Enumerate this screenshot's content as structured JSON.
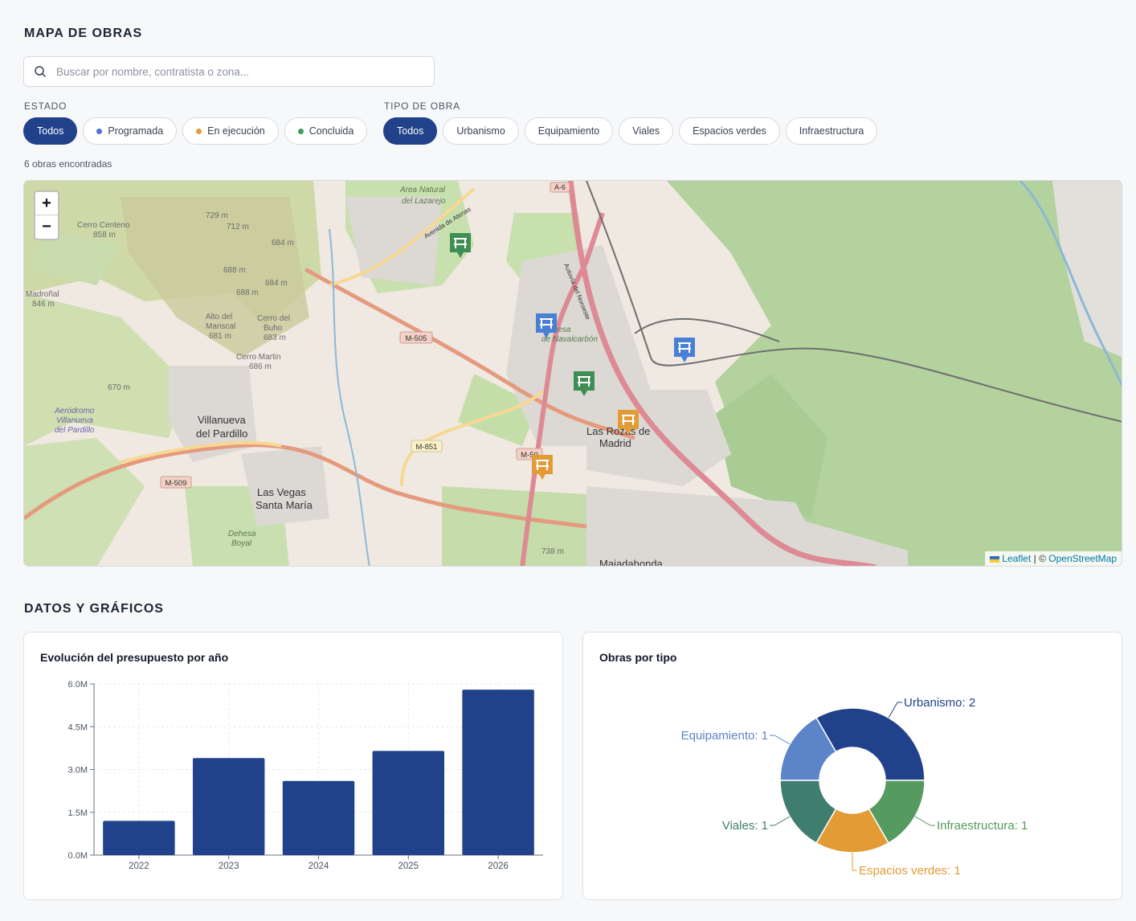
{
  "page": {
    "map_title": "MAPA DE OBRAS",
    "data_title": "DATOS Y GRÁFICOS"
  },
  "search": {
    "placeholder": "Buscar por nombre, contratista o zona...",
    "value": ""
  },
  "filters": {
    "estado_label": "ESTADO",
    "estado_options": [
      {
        "label": "Todos",
        "active": true,
        "dot": null
      },
      {
        "label": "Programada",
        "active": false,
        "dot": "#4a74d4"
      },
      {
        "label": "En ejecución",
        "active": false,
        "dot": "#e39b36"
      },
      {
        "label": "Concluida",
        "active": false,
        "dot": "#3f9a5e"
      }
    ],
    "tipo_label": "TIPO DE OBRA",
    "tipo_options": [
      {
        "label": "Todos",
        "active": true
      },
      {
        "label": "Urbanismo",
        "active": false
      },
      {
        "label": "Equipamiento",
        "active": false
      },
      {
        "label": "Viales",
        "active": false
      },
      {
        "label": "Espacios verdes",
        "active": false
      },
      {
        "label": "Infraestructura",
        "active": false
      }
    ]
  },
  "results": {
    "count_text": "6 obras encontradas"
  },
  "map": {
    "zoom_in": "+",
    "zoom_out": "−",
    "attribution": {
      "leaflet": "Leaflet",
      "separator": " | © ",
      "osm": "OpenStreetMap"
    },
    "labels": [
      "Area Natural",
      "del Lazarejo",
      "A-6",
      "729 m",
      "712 m",
      "684 m",
      "Cerro Centeno",
      "858 m",
      "688 m",
      "684 m",
      "688 m",
      "Madroñal",
      "846 m",
      "Alto del",
      "Mariscal",
      "681 m",
      "Cerro del",
      "Buho",
      "683 m",
      "Cerro Martin",
      "686 m",
      "670 m",
      "Aeródromo",
      "Villanueva",
      "del Pardillo",
      "Villanueva",
      "del Pardillo",
      "M-505",
      "M-851",
      "M-509",
      "M-50",
      "Las Vegas",
      "Santa María",
      "Las Rozas de",
      "Madrid",
      "Dehesa",
      "de Navalcarbón",
      "Dehesa",
      "Boyal",
      "738 m",
      "Majadahonda",
      "Autovía del Noroeste",
      "Avenida de Atenas"
    ],
    "markers": [
      {
        "status": "Concluida",
        "color": "#3f8e54"
      },
      {
        "status": "Programada",
        "color": "#4a7fd6"
      },
      {
        "status": "Programada",
        "color": "#4a7fd6"
      },
      {
        "status": "Concluida",
        "color": "#3f8e54"
      },
      {
        "status": "En ejecución",
        "color": "#e39b36"
      },
      {
        "status": "En ejecución",
        "color": "#e39b36"
      }
    ]
  },
  "charts": {
    "budget_title": "Evolución del presupuesto por año",
    "types_title": "Obras por tipo"
  },
  "chart_data": [
    {
      "type": "bar",
      "title": "Evolución del presupuesto por año",
      "categories": [
        "2022",
        "2023",
        "2024",
        "2025",
        "2026"
      ],
      "values": [
        1200000,
        3400000,
        2600000,
        3650000,
        5800000
      ],
      "yticks": [
        "0.0M",
        "1.5M",
        "3.0M",
        "4.5M",
        "6.0M"
      ],
      "ylim": [
        0,
        6000000
      ],
      "grid": true,
      "color": "#21428a"
    },
    {
      "type": "pie",
      "title": "Obras por tipo",
      "labels": [
        "Urbanismo",
        "Infraestructura",
        "Espacios verdes",
        "Viales",
        "Equipamiento"
      ],
      "values": [
        2,
        1,
        1,
        1,
        1
      ],
      "display_labels": [
        "Urbanismo: 2",
        "Infraestructura: 1",
        "Espacios verdes: 1",
        "Viales: 1",
        "Equipamiento: 1"
      ],
      "colors": [
        "#21428a",
        "#559a5e",
        "#e39b36",
        "#3f7d6e",
        "#5b84c9"
      ],
      "donut": true
    }
  ]
}
